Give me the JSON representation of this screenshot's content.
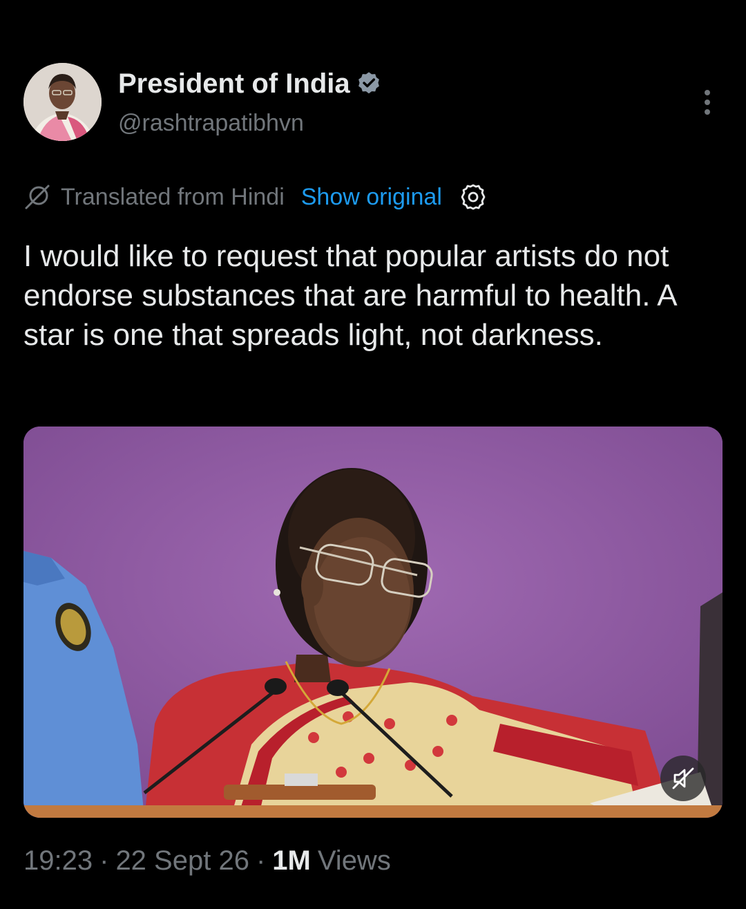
{
  "author": {
    "display_name": "President of India",
    "handle": "@rashtrapatibhvn",
    "verified_icon": "verified-badge-icon",
    "verified_color": "#8b98a5"
  },
  "translation": {
    "label": "Translated from Hindi",
    "show_original": "Show original",
    "link_color": "#1d9bf0"
  },
  "tweet": {
    "text": "I would like to request that popular artists do not endorse substances that are harmful to health. A star is one that spreads light, not darkness."
  },
  "media": {
    "type": "video",
    "muted": true,
    "mute_icon": "speaker-muted-icon"
  },
  "meta": {
    "time": "19:23",
    "date": "22 Sept 26",
    "views_count": "1M",
    "views_label": "Views",
    "separator": "·"
  },
  "colors": {
    "background": "#000000",
    "text_primary": "#e7e9ea",
    "text_secondary": "#71767b"
  }
}
